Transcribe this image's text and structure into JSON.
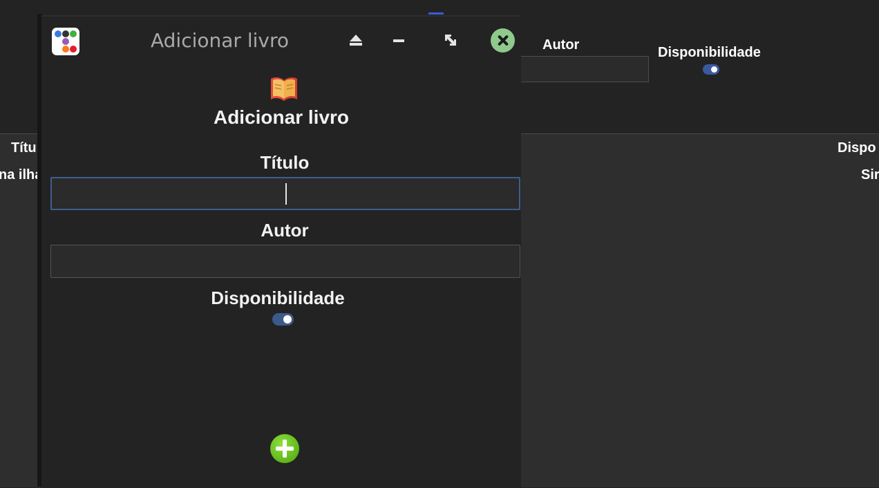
{
  "background": {
    "author_label": "Autor",
    "availability_label": "Disponibilidade",
    "table_header_title": "Títu",
    "table_header_availability": "Dispo",
    "row_title": "na ilha",
    "row_availability": "Sir"
  },
  "dialog": {
    "window_title": "Adicionar livro",
    "heading": "Adicionar livro",
    "title_label": "Título",
    "title_value": "",
    "author_label": "Autor",
    "author_value": "",
    "availability_label": "Disponibilidade",
    "availability_on": true,
    "icons": {
      "app": "app-dots-icon",
      "eject": "eject-icon",
      "minimize": "minimize-icon",
      "maximize": "maximize-icon",
      "close": "close-icon",
      "book": "open-book-icon",
      "add": "add-plus-icon"
    }
  },
  "colors": {
    "accent": "#3a5a8a",
    "close": "#8fc98b",
    "add": "#5bbf16"
  }
}
